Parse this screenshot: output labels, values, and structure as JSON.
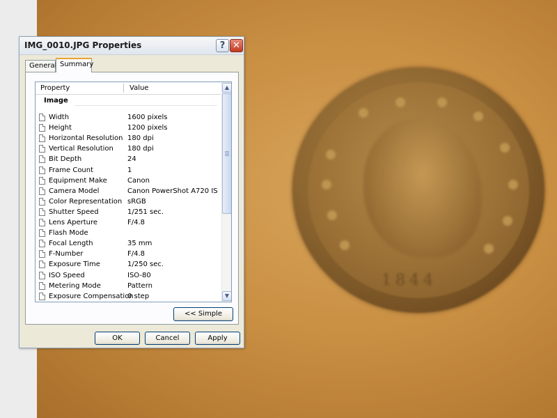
{
  "dialog": {
    "title": "IMG_0010.JPG Properties",
    "help_label": "?",
    "close_label": "✕",
    "tabs": [
      {
        "label": "General",
        "active": false
      },
      {
        "label": "Summary",
        "active": true
      }
    ]
  },
  "list": {
    "columns": {
      "property": "Property",
      "value": "Value"
    },
    "group": "Image",
    "rows": [
      {
        "property": "Width",
        "value": "1600 pixels"
      },
      {
        "property": "Height",
        "value": "1200 pixels"
      },
      {
        "property": "Horizontal Resolution",
        "value": "180 dpi"
      },
      {
        "property": "Vertical Resolution",
        "value": "180 dpi"
      },
      {
        "property": "Bit Depth",
        "value": "24"
      },
      {
        "property": "Frame Count",
        "value": "1"
      },
      {
        "property": "Equipment Make",
        "value": "Canon"
      },
      {
        "property": "Camera Model",
        "value": "Canon PowerShot A720 IS"
      },
      {
        "property": "Color Representation",
        "value": "sRGB"
      },
      {
        "property": "Shutter Speed",
        "value": "1/251 sec."
      },
      {
        "property": "Lens Aperture",
        "value": "F/4.8"
      },
      {
        "property": "Flash Mode",
        "value": ""
      },
      {
        "property": "Focal Length",
        "value": "35 mm"
      },
      {
        "property": "F-Number",
        "value": "F/4.8"
      },
      {
        "property": "Exposure Time",
        "value": "1/250 sec."
      },
      {
        "property": "ISO Speed",
        "value": "ISO-80"
      },
      {
        "property": "Metering Mode",
        "value": "Pattern"
      },
      {
        "property": "Exposure Compensation",
        "value": "0 step"
      }
    ]
  },
  "buttons": {
    "simple": "<< Simple",
    "ok": "OK",
    "cancel": "Cancel",
    "apply": "Apply"
  },
  "background": {
    "coin_date": "1844"
  },
  "colors": {
    "title_accent": "#e7a33a",
    "close_button": "#c13b22",
    "photo_base": "#c98f43"
  },
  "icons": {
    "row_icon": "document-icon",
    "scroll_up": "arrow-up-icon",
    "scroll_down": "arrow-down-icon"
  }
}
